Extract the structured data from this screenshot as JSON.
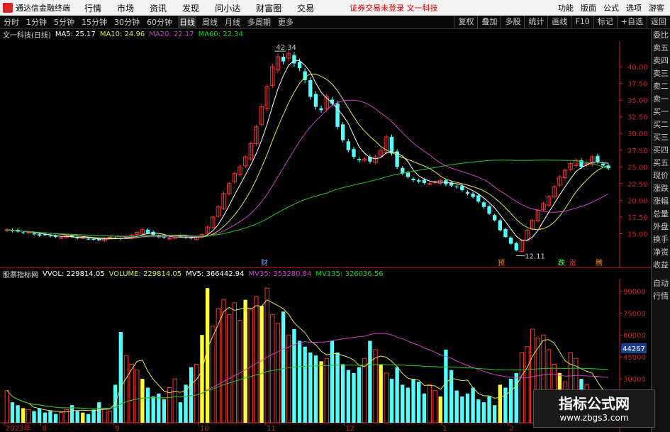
{
  "app": {
    "title": "通达信金融终端"
  },
  "menu": [
    "行情",
    "市场",
    "资讯",
    "发现",
    "问小达",
    "财富圈",
    "交易"
  ],
  "center_notice": "证券交易未登录  文一科技",
  "top_right": [
    "功能",
    "版面",
    "公式",
    "选项",
    "游客"
  ],
  "timeframes": [
    "分时",
    "1分钟",
    "5分钟",
    "15分钟",
    "30分钟",
    "60分钟",
    "日线",
    "周线",
    "月线",
    "多周期",
    "更多"
  ],
  "active_timeframe": "日线",
  "toolbar_right": [
    "复权",
    "叠加",
    "多股",
    "统计",
    "画线",
    "F10",
    "标记",
    "+自选",
    "返回"
  ],
  "price_legend": {
    "stock": "文一科技(日线)",
    "ma5": "MA5: 25.17",
    "ma10": "MA10: 24.96",
    "ma20": "MA20: 22.17",
    "ma60": "MA60: 22.34"
  },
  "volume_legend": {
    "name": "股票指标网",
    "vvol": "VVOL: 229814.05",
    "volume": "VOLUME: 229814.05",
    "mv5": "MV5: 366442.94",
    "mv35": "MV35: 353280.84",
    "mv135": "MV135: 326036.56"
  },
  "sidebar": [
    "委比",
    "卖五",
    "卖四",
    "卖三",
    "卖二",
    "卖一",
    "买一",
    "买二",
    "买三",
    "买四",
    "买五",
    "现价",
    "涨跌",
    "涨幅",
    "总量",
    "外盘",
    "换手",
    "净资",
    "收益"
  ],
  "sidebar_vol": [
    "自动",
    "行情"
  ],
  "annotations": {
    "high": "42.34",
    "low": "12.11",
    "cai": "财",
    "yu": "预",
    "die": "跌",
    "zhang": "涨",
    "teng": "腾"
  },
  "current_volume_label": "44267",
  "watermark": {
    "line1": "指标公式网",
    "line2": "www.zbgs3.com"
  },
  "colors": {
    "up": "#ff3232",
    "down": "#54ffff",
    "ma5": "#ffffff",
    "ma10": "#e6e64c",
    "ma20": "#cc44cc",
    "ma60": "#22cc22",
    "axis": "#cc2222",
    "yellow_vol": "#ffff33"
  },
  "chart_data": {
    "type": "candlestick",
    "y_axis_ticks": [
      "40.00",
      "37.50",
      "35.00",
      "32.50",
      "30.00",
      "27.50",
      "25.00",
      "22.50",
      "20.00",
      "17.50",
      "15.00"
    ],
    "y_range": [
      12.11,
      42.34
    ],
    "volume_ticks": [
      "90000",
      "75000",
      "60000",
      "45000",
      "30000"
    ],
    "x_tick_labels": [
      "2023年",
      "8",
      "9",
      "10",
      "11",
      "12",
      "1",
      "2"
    ],
    "close_prices": [
      15.6,
      15.4,
      15.3,
      15.1,
      15.2,
      14.9,
      14.7,
      14.8,
      14.6,
      14.5,
      14.4,
      14.6,
      14.5,
      14.3,
      14.4,
      14.2,
      14.1,
      14.0,
      14.3,
      14.5,
      14.3,
      14.2,
      14.4,
      14.8,
      15.2,
      15.6,
      15.1,
      14.8,
      14.5,
      14.4,
      14.3,
      14.5,
      14.6,
      14.4,
      14.3,
      14.5,
      14.9,
      16.0,
      17.5,
      19.0,
      21.0,
      22.5,
      24.0,
      25.0,
      26.5,
      28.5,
      31.0,
      34.0,
      37.0,
      40.0,
      41.5,
      40.8,
      42.0,
      40.5,
      39.8,
      38.0,
      35.5,
      34.0,
      33.5,
      35.5,
      34.5,
      31.0,
      29.0,
      27.5,
      26.5,
      26.0,
      26.2,
      25.8,
      26.5,
      27.5,
      29.5,
      27.0,
      25.0,
      24.0,
      23.5,
      23.0,
      22.8,
      22.6,
      22.5,
      22.8,
      23.0,
      22.4,
      22.2,
      22.0,
      21.5,
      21.0,
      20.5,
      19.8,
      19.0,
      18.0,
      17.0,
      15.5,
      14.5,
      13.5,
      12.5,
      14.0,
      15.5,
      17.0,
      18.5,
      19.5,
      20.5,
      22.0,
      23.5,
      24.5,
      25.5,
      26.0,
      25.0,
      25.5,
      26.5,
      25.8,
      25.2,
      24.8
    ],
    "volumes": [
      22000,
      14000,
      12000,
      10000,
      9000,
      8000,
      10000,
      7000,
      8000,
      6000,
      7000,
      9000,
      12000,
      8000,
      7000,
      6000,
      9000,
      14000,
      10000,
      8000,
      26000,
      62000,
      46000,
      40000,
      36000,
      30000,
      24000,
      18000,
      20000,
      16000,
      24000,
      30000,
      14000,
      26000,
      38000,
      40000,
      60000,
      92000,
      66000,
      78000,
      84000,
      74000,
      82000,
      70000,
      84000,
      78000,
      86000,
      80000,
      92000,
      74000,
      68000,
      76000,
      60000,
      64000,
      56000,
      52000,
      48000,
      46000,
      42000,
      44000,
      56000,
      48000,
      40000,
      36000,
      34000,
      38000,
      44000,
      56000,
      50000,
      40000,
      34000,
      30000,
      38000,
      26000,
      24000,
      30000,
      28000,
      20000,
      26000,
      22000,
      18000,
      50000,
      36000,
      22000,
      18000,
      20000,
      24000,
      16000,
      14000,
      18000,
      12000,
      26000,
      24000,
      30000,
      34000,
      48000,
      52000,
      64000,
      58000,
      60000,
      50000,
      40000,
      34000,
      28000,
      48000,
      44000,
      30000,
      26000,
      22000,
      18000,
      16000,
      14000
    ]
  }
}
